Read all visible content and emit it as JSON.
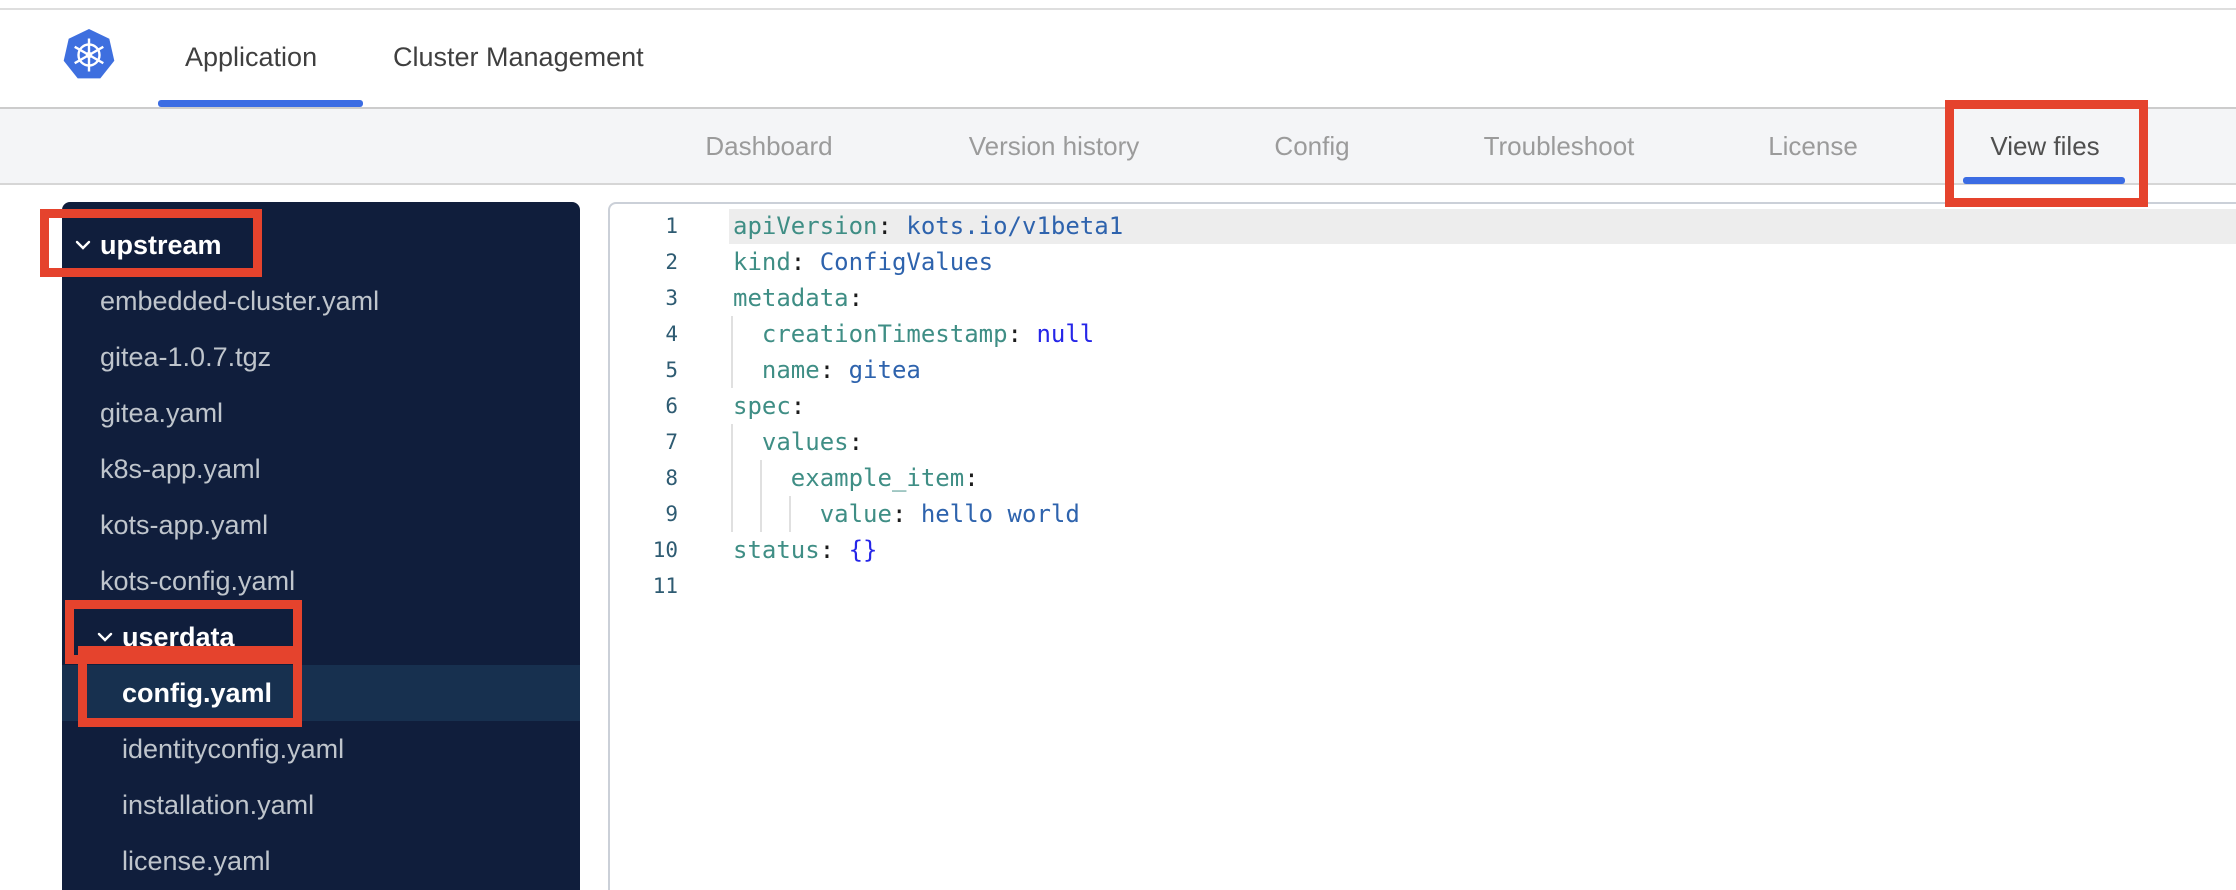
{
  "header": {
    "brand_icon": "kubernetes-logo",
    "tabs": [
      {
        "label": "Application",
        "active": true
      },
      {
        "label": "Cluster Management",
        "active": false
      }
    ]
  },
  "subnav": {
    "tabs": [
      {
        "label": "Dashboard",
        "active": false
      },
      {
        "label": "Version history",
        "active": false
      },
      {
        "label": "Config",
        "active": false
      },
      {
        "label": "Troubleshoot",
        "active": false
      },
      {
        "label": "License",
        "active": false
      },
      {
        "label": "View files",
        "active": true
      }
    ]
  },
  "file_tree": {
    "items": [
      {
        "type": "folder",
        "label": "upstream",
        "level": 0,
        "expanded": true,
        "annotated": true
      },
      {
        "type": "file",
        "label": "embedded-cluster.yaml",
        "level": 1
      },
      {
        "type": "file",
        "label": "gitea-1.0.7.tgz",
        "level": 1
      },
      {
        "type": "file",
        "label": "gitea.yaml",
        "level": 1
      },
      {
        "type": "file",
        "label": "k8s-app.yaml",
        "level": 1
      },
      {
        "type": "file",
        "label": "kots-app.yaml",
        "level": 1
      },
      {
        "type": "file",
        "label": "kots-config.yaml",
        "level": 1
      },
      {
        "type": "folder",
        "label": "userdata",
        "level": 1,
        "expanded": true,
        "annotated": true
      },
      {
        "type": "file",
        "label": "config.yaml",
        "level": 2,
        "selected": true,
        "annotated": true
      },
      {
        "type": "file",
        "label": "identityconfig.yaml",
        "level": 2
      },
      {
        "type": "file",
        "label": "installation.yaml",
        "level": 2
      },
      {
        "type": "file",
        "label": "license.yaml",
        "level": 2
      }
    ]
  },
  "editor": {
    "language": "yaml",
    "active_line": 1,
    "lines": [
      {
        "n": "1",
        "indent": 0,
        "tokens": [
          {
            "t": "key",
            "v": "apiVersion"
          },
          {
            "t": "p",
            "v": ":"
          },
          {
            "t": "str",
            "v": " kots.io/v1beta1"
          }
        ]
      },
      {
        "n": "2",
        "indent": 0,
        "tokens": [
          {
            "t": "key",
            "v": "kind"
          },
          {
            "t": "p",
            "v": ":"
          },
          {
            "t": "str",
            "v": " ConfigValues"
          }
        ]
      },
      {
        "n": "3",
        "indent": 0,
        "tokens": [
          {
            "t": "key",
            "v": "metadata"
          },
          {
            "t": "p",
            "v": ":"
          }
        ]
      },
      {
        "n": "4",
        "indent": 2,
        "tokens": [
          {
            "t": "sp",
            "v": "  "
          },
          {
            "t": "key",
            "v": "creationTimestamp"
          },
          {
            "t": "p",
            "v": ":"
          },
          {
            "t": "const",
            "v": " null"
          }
        ]
      },
      {
        "n": "5",
        "indent": 2,
        "tokens": [
          {
            "t": "sp",
            "v": "  "
          },
          {
            "t": "key",
            "v": "name"
          },
          {
            "t": "p",
            "v": ":"
          },
          {
            "t": "str",
            "v": " gitea"
          }
        ]
      },
      {
        "n": "6",
        "indent": 0,
        "tokens": [
          {
            "t": "key",
            "v": "spec"
          },
          {
            "t": "p",
            "v": ":"
          }
        ]
      },
      {
        "n": "7",
        "indent": 2,
        "tokens": [
          {
            "t": "sp",
            "v": "  "
          },
          {
            "t": "key",
            "v": "values"
          },
          {
            "t": "p",
            "v": ":"
          }
        ]
      },
      {
        "n": "8",
        "indent": 4,
        "tokens": [
          {
            "t": "sp",
            "v": "    "
          },
          {
            "t": "key",
            "v": "example_item"
          },
          {
            "t": "p",
            "v": ":"
          }
        ]
      },
      {
        "n": "9",
        "indent": 6,
        "tokens": [
          {
            "t": "sp",
            "v": "      "
          },
          {
            "t": "key",
            "v": "value"
          },
          {
            "t": "p",
            "v": ":"
          },
          {
            "t": "str",
            "v": " hello world"
          }
        ]
      },
      {
        "n": "10",
        "indent": 0,
        "tokens": [
          {
            "t": "key",
            "v": "status"
          },
          {
            "t": "p",
            "v": ":"
          },
          {
            "t": "const",
            "v": " {}"
          }
        ]
      },
      {
        "n": "11",
        "indent": 0,
        "tokens": []
      }
    ]
  },
  "annotations": {
    "color": "#e5432d",
    "boxes": [
      "view-files-tab",
      "upstream-folder",
      "userdata-folder",
      "config-yaml-file"
    ]
  },
  "colors": {
    "accent_blue": "#3b6ce3",
    "logo_blue": "#3e6fdf",
    "sidebar_bg": "#101e3c",
    "sidebar_selected_bg": "#17304f",
    "subnav_bg": "#f4f5f7",
    "syntax_key": "#3f8e85",
    "syntax_value": "#2e63ad",
    "syntax_constant": "#2626e8"
  }
}
